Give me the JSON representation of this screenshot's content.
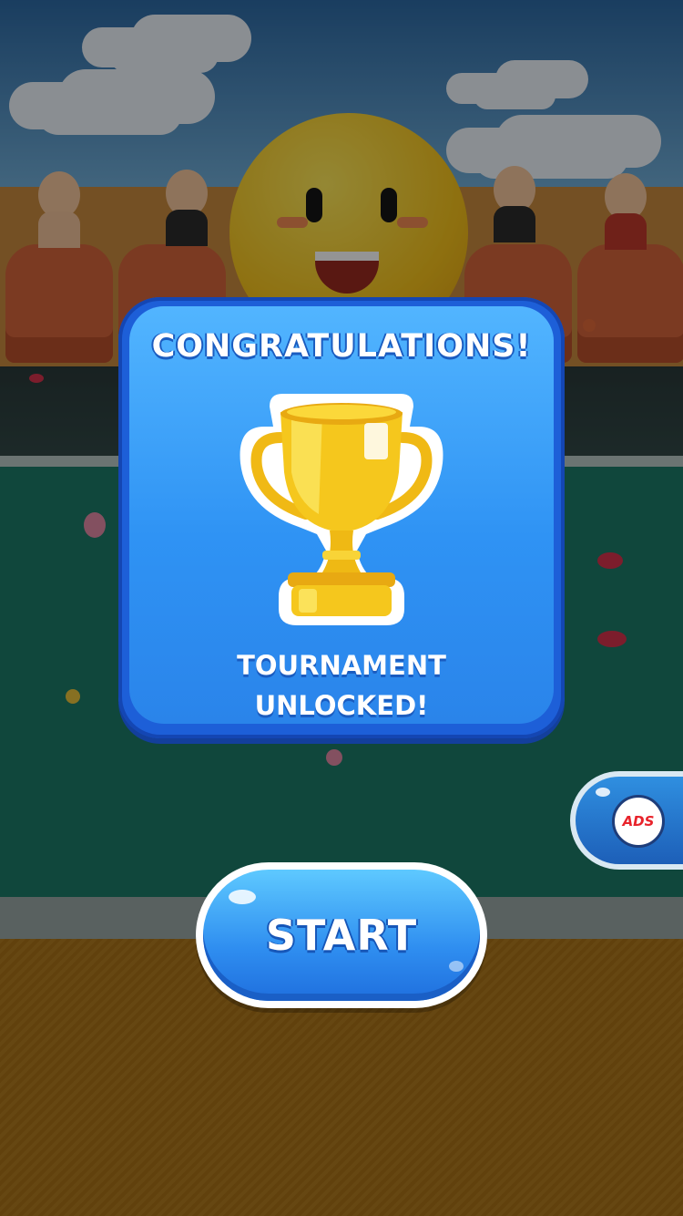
{
  "dialog": {
    "title": "CONGRATULATIONS!",
    "message_line1": "TOURNAMENT",
    "message_line2": "UNLOCKED!",
    "icon": "trophy-icon"
  },
  "buttons": {
    "start_label": "START",
    "ads_label": "ADS"
  },
  "colors": {
    "dialog_blue": "#2f93f4",
    "trophy_gold": "#f5c71d",
    "button_blue": "#2f8ef0",
    "ads_red": "#e8232b"
  }
}
